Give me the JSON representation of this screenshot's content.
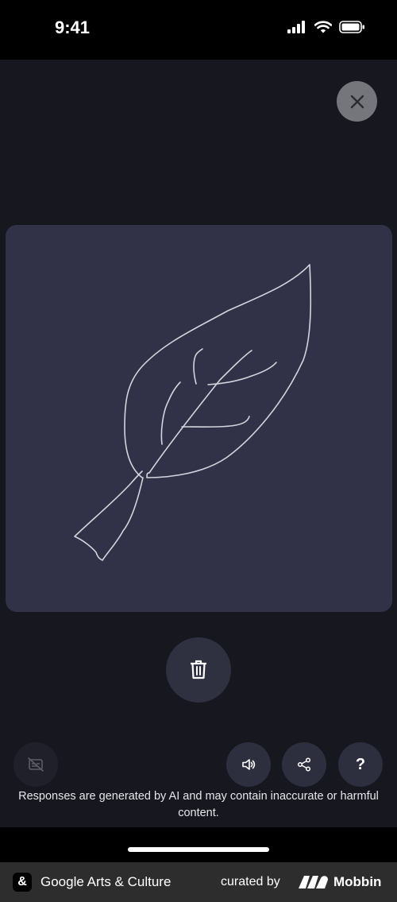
{
  "status_bar": {
    "time": "9:41",
    "icons": [
      "signal-icon",
      "wifi-icon",
      "battery-icon"
    ]
  },
  "toolbar": {
    "close_icon": "close-icon"
  },
  "canvas": {
    "background": "#313248",
    "stroke_color": "#d4d5dc",
    "drawing": "leaf sketch"
  },
  "actions": {
    "delete_icon": "trash-icon",
    "captions_icon": "captions-off-icon",
    "sound_icon": "speaker-icon",
    "share_icon": "share-icon",
    "help_label": "?"
  },
  "disclaimer": "Responses are generated by AI and may contain inaccurate or harmful content.",
  "footer": {
    "logo_glyph": "&",
    "app_name": "Google Arts & Culture",
    "curated_by": "curated by",
    "brand": "Mobbin"
  },
  "colors": {
    "background": "#17171f",
    "button": "#2f3040",
    "close_button": "#75757c",
    "footer": "#2d2d2d"
  }
}
